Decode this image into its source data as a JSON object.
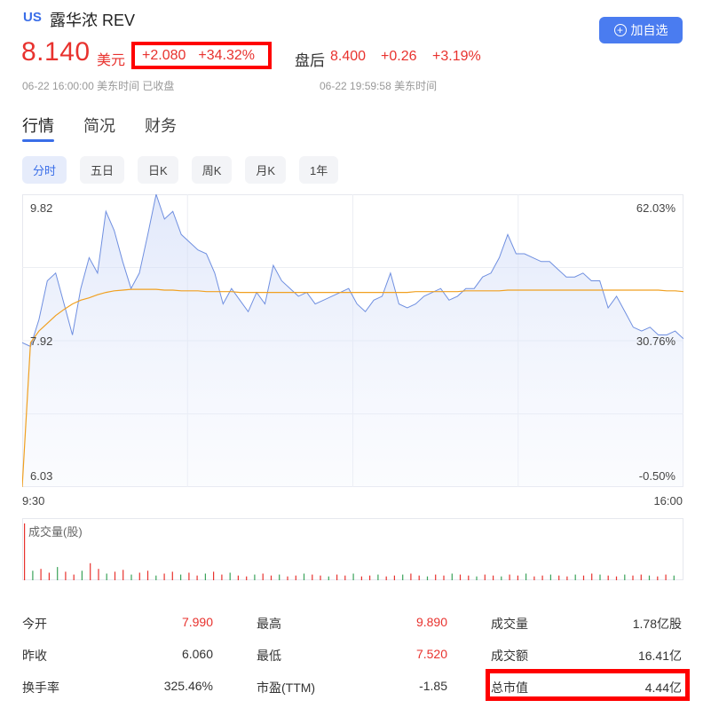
{
  "header": {
    "market_badge": "US",
    "stock_name": "露华浓 REV",
    "add_watch_label": "加自选",
    "plus_icon": "plus-circle-icon",
    "price": "8.140",
    "currency": "美元",
    "change": "+2.080",
    "change_pct": "+34.32%",
    "after_hours_label": "盘后",
    "after_hours_price": "8.400",
    "after_hours_change": "+0.26",
    "after_hours_pct": "+3.19%",
    "close_time": "06-22 16:00:00 美东时间 已收盘",
    "after_hours_time": "06-22 19:59:58 美东时间"
  },
  "tabs": [
    "行情",
    "简况",
    "财务"
  ],
  "periods": [
    "分时",
    "五日",
    "日K",
    "周K",
    "月K",
    "1年"
  ],
  "chart_labels": {
    "y_top": "9.82",
    "y_mid": "7.92",
    "y_bottom": "6.03",
    "pct_top": "62.03%",
    "pct_mid": "30.76%",
    "pct_bottom": "-0.50%",
    "x_start": "9:30",
    "x_end": "16:00",
    "volume_title": "成交量(股)"
  },
  "colors": {
    "up": "#e8322e",
    "accent": "#3a6ee8",
    "price_line": "#6f8fe0",
    "avg_line": "#f0a020"
  },
  "chart_data": {
    "type": "line",
    "x_range": [
      "9:30",
      "16:00"
    ],
    "ylim": [
      6.03,
      9.82
    ],
    "pct_range": [
      "-0.50%",
      "62.03%"
    ],
    "series": [
      {
        "values": [
          7.9,
          7.85,
          8.2,
          8.7,
          8.8,
          8.4,
          8.0,
          8.6,
          9.0,
          8.8,
          9.6,
          9.35,
          8.95,
          8.6,
          8.8,
          9.3,
          9.82,
          9.5,
          9.6,
          9.3,
          9.2,
          9.1,
          9.05,
          8.8,
          8.4,
          8.6,
          8.45,
          8.3,
          8.55,
          8.4,
          8.9,
          8.7,
          8.6,
          8.5,
          8.55,
          8.4,
          8.45,
          8.5,
          8.55,
          8.6,
          8.4,
          8.3,
          8.45,
          8.5,
          8.8,
          8.4,
          8.35,
          8.4,
          8.5,
          8.55,
          8.6,
          8.45,
          8.5,
          8.6,
          8.6,
          8.75,
          8.8,
          9.0,
          9.3,
          9.05,
          9.05,
          9.0,
          8.95,
          8.95,
          8.85,
          8.75,
          8.75,
          8.8,
          8.7,
          8.7,
          8.35,
          8.5,
          8.3,
          8.1,
          8.05,
          8.1,
          8.0,
          8.0,
          8.05,
          7.95
        ]
      },
      {
        "values": [
          6.03,
          7.9,
          8.05,
          8.15,
          8.25,
          8.33,
          8.4,
          8.45,
          8.48,
          8.52,
          8.55,
          8.57,
          8.58,
          8.59,
          8.59,
          8.59,
          8.59,
          8.58,
          8.58,
          8.57,
          8.57,
          8.57,
          8.56,
          8.56,
          8.56,
          8.56,
          8.55,
          8.55,
          8.55,
          8.55,
          8.55,
          8.55,
          8.55,
          8.55,
          8.55,
          8.55,
          8.55,
          8.55,
          8.55,
          8.55,
          8.55,
          8.55,
          8.55,
          8.55,
          8.55,
          8.55,
          8.55,
          8.56,
          8.56,
          8.56,
          8.56,
          8.56,
          8.56,
          8.57,
          8.57,
          8.57,
          8.57,
          8.57,
          8.58,
          8.58,
          8.58,
          8.58,
          8.58,
          8.58,
          8.58,
          8.58,
          8.58,
          8.58,
          8.58,
          8.58,
          8.58,
          8.58,
          8.58,
          8.58,
          8.58,
          8.58,
          8.58,
          8.57,
          8.57,
          8.56
        ]
      }
    ],
    "volume": [
      60,
      10,
      12,
      8,
      14,
      9,
      6,
      10,
      18,
      12,
      7,
      9,
      11,
      6,
      8,
      10,
      5,
      7,
      9,
      6,
      8,
      5,
      7,
      9,
      6,
      8,
      5,
      4,
      6,
      7,
      5,
      6,
      4,
      5,
      7,
      6,
      5,
      4,
      6,
      5,
      7,
      4,
      5,
      6,
      4,
      5,
      6,
      7,
      5,
      4,
      6,
      5,
      7,
      6,
      5,
      4,
      6,
      5,
      4,
      6,
      5,
      7,
      4,
      5,
      6,
      5,
      4,
      6,
      5,
      7,
      6,
      5,
      4,
      6,
      5,
      6,
      5,
      4,
      6,
      5
    ]
  },
  "stats": [
    {
      "label": "今开",
      "value": "7.990",
      "color": "red"
    },
    {
      "label": "最高",
      "value": "9.890",
      "color": "red"
    },
    {
      "label": "成交量",
      "value": "1.78亿股",
      "color": "dark"
    },
    {
      "label": "昨收",
      "value": "6.060",
      "color": "dark"
    },
    {
      "label": "最低",
      "value": "7.520",
      "color": "red"
    },
    {
      "label": "成交额",
      "value": "16.41亿",
      "color": "dark"
    },
    {
      "label": "换手率",
      "value": "325.46%",
      "color": "dark"
    },
    {
      "label": "市盈(TTM)",
      "value": "-1.85",
      "color": "dark"
    },
    {
      "label": "总市值",
      "value": "4.44亿",
      "color": "dark"
    }
  ]
}
